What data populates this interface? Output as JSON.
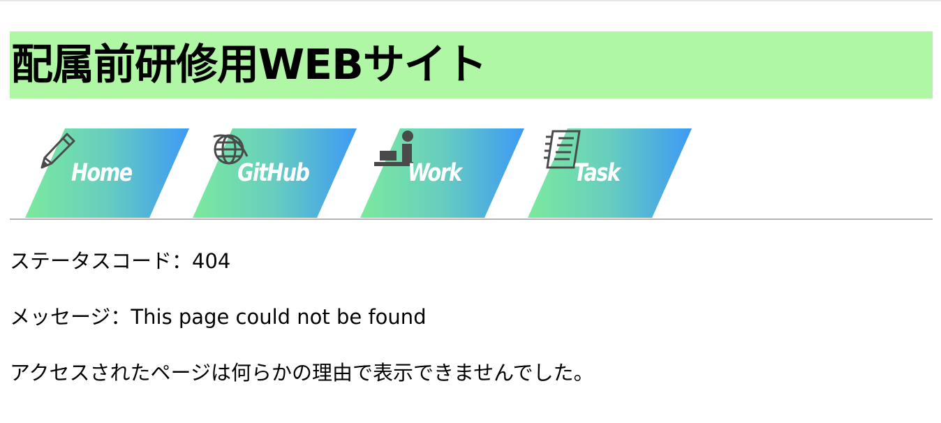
{
  "header": {
    "title": "配属前研修用WEBサイト"
  },
  "nav": {
    "items": [
      {
        "label": "Home",
        "icon": "pencil-icon"
      },
      {
        "label": "GitHub",
        "icon": "globe-icon"
      },
      {
        "label": "Work",
        "icon": "worker-at-desk-icon"
      },
      {
        "label": "Task",
        "icon": "notebook-icon"
      }
    ]
  },
  "content": {
    "status": "ステータスコード：404",
    "message": "メッセージ：This page could not be found",
    "description": "アクセスされたページは何らかの理由で表示できませんでした。"
  },
  "colors": {
    "title_bg": "#b0f7a5",
    "tab_gradient_start": "#7aea9d",
    "tab_gradient_end": "#3d9af5",
    "icon": "#4a4a4a"
  }
}
